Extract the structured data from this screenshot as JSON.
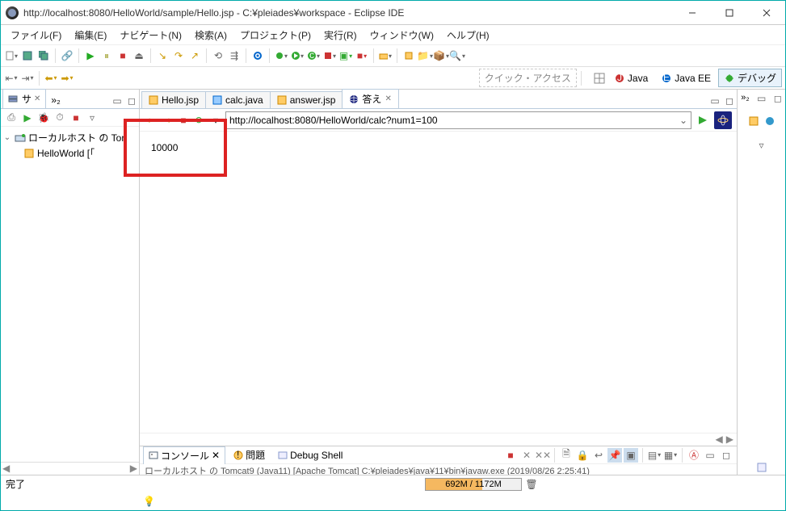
{
  "window": {
    "title": "http://localhost:8080/HelloWorld/sample/Hello.jsp - C:¥pleiades¥workspace - Eclipse IDE"
  },
  "menu": {
    "file": "ファイル(F)",
    "edit": "編集(E)",
    "navigate": "ナビゲート(N)",
    "search": "検索(A)",
    "project": "プロジェクト(P)",
    "run": "実行(R)",
    "window": "ウィンドウ(W)",
    "help": "ヘルプ(H)"
  },
  "quick_access": "クイック・アクセス",
  "perspectives": {
    "java": "Java",
    "javaee": "Java EE",
    "debug": "デバッグ"
  },
  "left_view": {
    "tab1": "サ",
    "tab2": "»₂",
    "tree": {
      "server": "ローカルホスト の Tor",
      "child": "HelloWorld [「"
    }
  },
  "editor": {
    "tabs": {
      "t1": "Hello.jsp",
      "t2": "calc.java",
      "t3": "answer.jsp",
      "t4": "答え"
    },
    "url": "http://localhost:8080/HelloWorld/calc?num1=100",
    "content": "10000"
  },
  "bottom": {
    "console": "コンソール",
    "problems": "問題",
    "debugshell": "Debug Shell",
    "line": "ローカルホスト の Tomcat9 (Java11) [Apache Tomcat] C:¥pleiades¥java¥11¥bin¥javaw.exe (2019/08/26 2:25:41)"
  },
  "right_view": {
    "tab": "»₂"
  },
  "status": {
    "done": "完了",
    "memory": "692M / 1172M"
  }
}
